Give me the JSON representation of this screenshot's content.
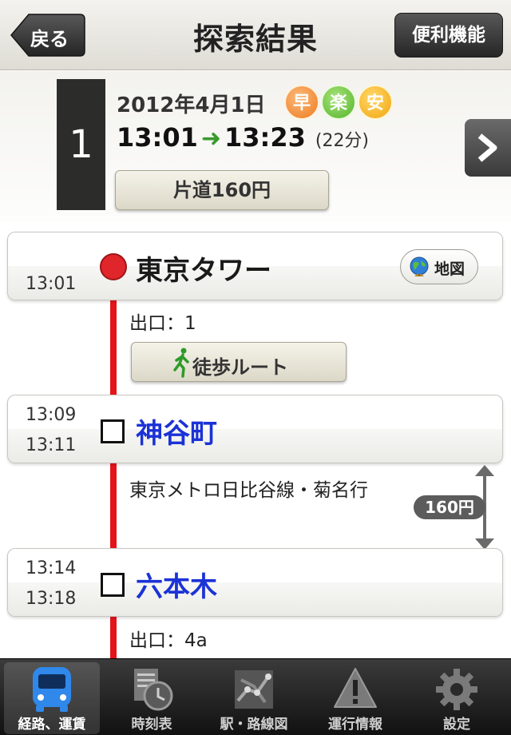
{
  "nav": {
    "back_label": "戻る",
    "title": "探索結果",
    "utility_label": "便利機能"
  },
  "summary": {
    "route_number": "1",
    "date": "2012年4月1日",
    "badges": [
      "早",
      "楽",
      "安"
    ],
    "depart": "13:01",
    "arrive": "13:23",
    "duration": "(22分)",
    "fare_label": "片道160円"
  },
  "route": {
    "origin": {
      "time": "13:01",
      "name": "東京タワー",
      "map_label": "地図"
    },
    "exit1": "出口：1",
    "walk_label": "徒歩ルート",
    "stop1": {
      "arrive": "13:09",
      "depart": "13:11",
      "name": "神谷町"
    },
    "line": "東京メトロ日比谷線・菊名行",
    "line_fare": "160円",
    "stop2": {
      "arrive": "13:14",
      "depart": "13:18",
      "name": "六本木"
    },
    "exit2": "出口：4a"
  },
  "tabs": [
    {
      "label": "経路、運賃",
      "icon": "bus-icon"
    },
    {
      "label": "時刻表",
      "icon": "timetable-clock-icon"
    },
    {
      "label": "駅・路線図",
      "icon": "route-map-icon"
    },
    {
      "label": "運行情報",
      "icon": "warning-icon"
    },
    {
      "label": "設定",
      "icon": "gear-icon"
    }
  ],
  "colors": {
    "rail": "#e4141b",
    "link": "#1b32d6",
    "origin_dot": "#e0262a"
  }
}
